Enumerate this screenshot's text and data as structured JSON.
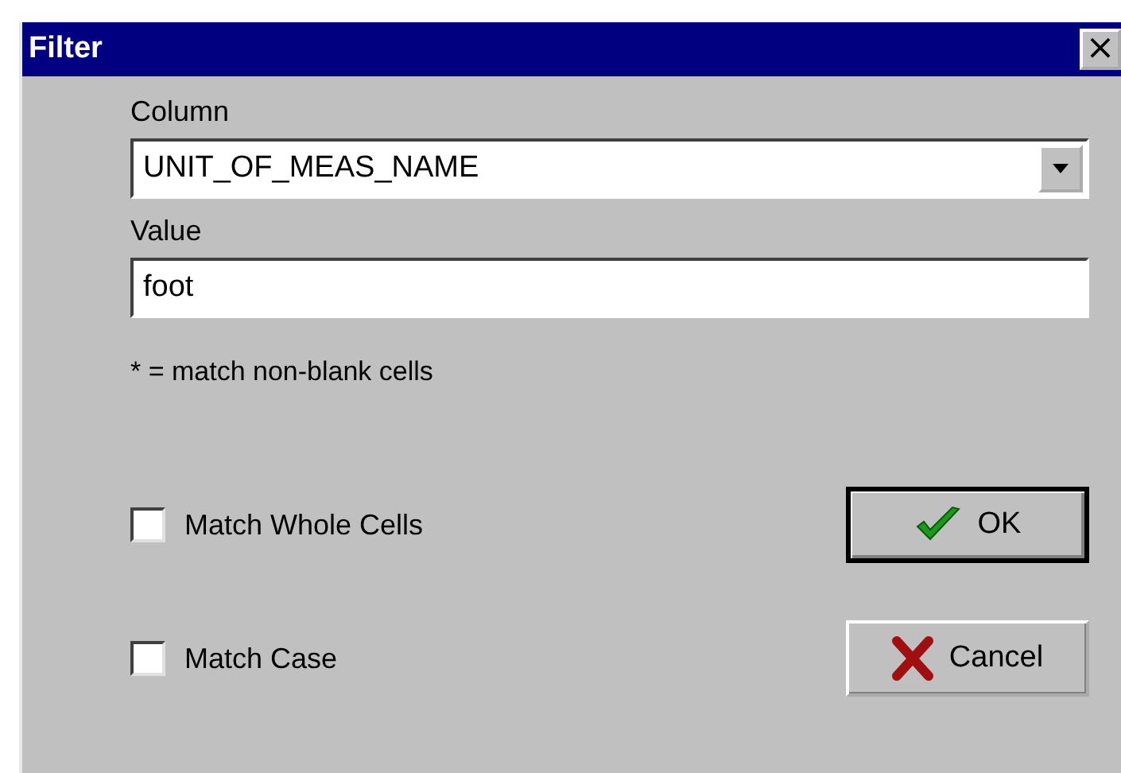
{
  "window": {
    "title": "Filter",
    "close": "×"
  },
  "column": {
    "label": "Column",
    "value": "UNIT_OF_MEAS_NAME"
  },
  "value": {
    "label": "Value",
    "value": "foot"
  },
  "note": "* = match non-blank cells",
  "options": [
    {
      "label": "Match Whole Cells",
      "checked": false
    },
    {
      "label": "Match Case",
      "checked": false
    }
  ],
  "buttons": [
    {
      "label": "OK",
      "kind": "ok",
      "default": true
    },
    {
      "label": "Cancel",
      "kind": "cancel",
      "default": false
    }
  ]
}
